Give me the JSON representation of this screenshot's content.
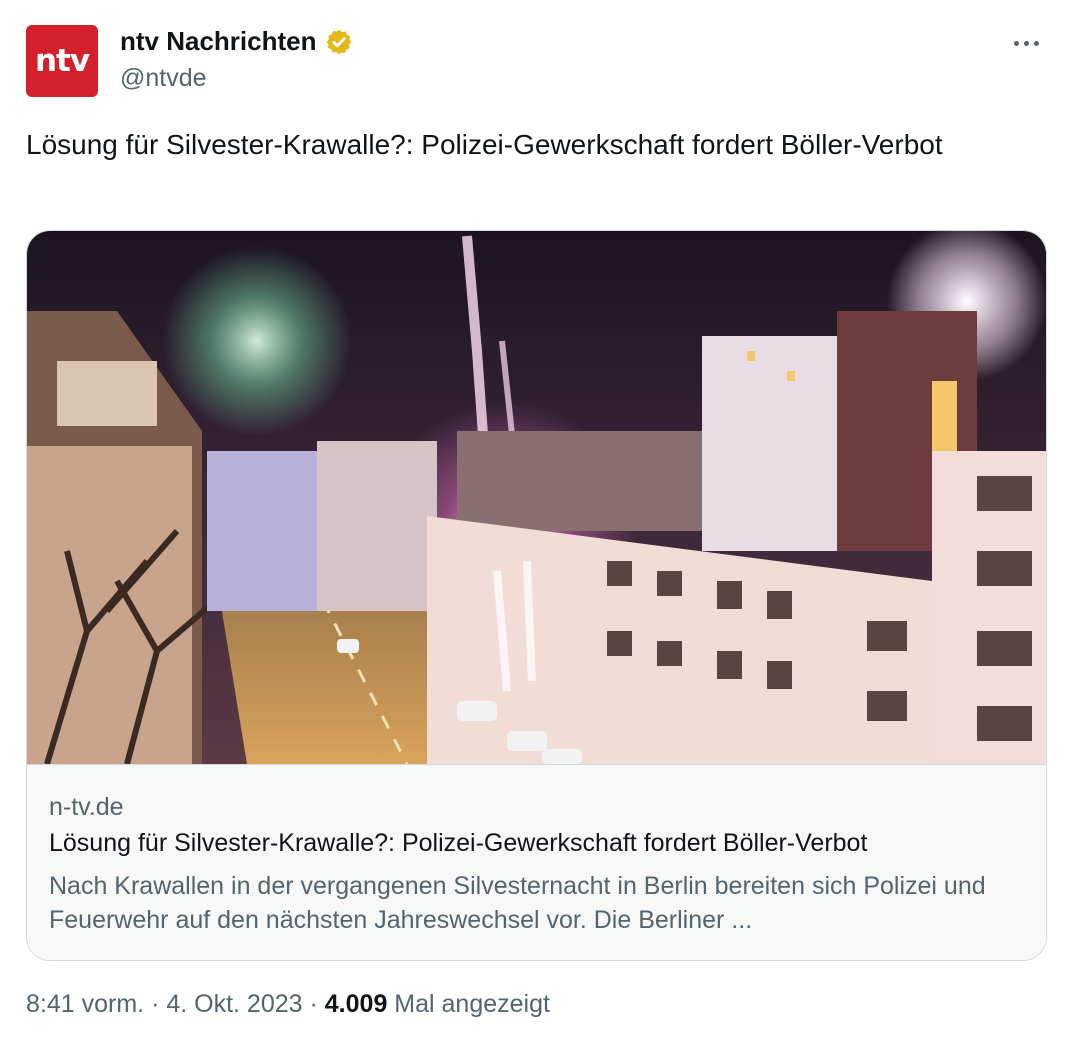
{
  "author": {
    "avatar_text": "ntv",
    "avatar_color": "#d3202a",
    "display_name": "ntv Nachrichten",
    "verified_badge": "gold-verified-icon",
    "handle": "@ntvde"
  },
  "more_icon": "more-horizontal-icon",
  "tweet": {
    "text": "Lösung für Silvester-Krawalle?: Polizei-Gewerkschaft fordert Böller-Verbot"
  },
  "link_card": {
    "image": "night-street-fireworks-photo",
    "domain": "n-tv.de",
    "title": "Lösung für Silvester-Krawalle?: Polizei-Gewerkschaft fordert Böller-Verbot",
    "description": "Nach Krawallen in der vergangenen Silvesternacht in Berlin bereiten sich Polizei und Feuerwehr auf den nächsten Jahreswechsel vor. Die Berliner ..."
  },
  "meta": {
    "time": "8:41 vorm.",
    "separator": "·",
    "date": "4. Okt. 2023",
    "views_count": "4.009",
    "views_label": "Mal angezeigt"
  },
  "colors": {
    "text_primary": "#0f1419",
    "text_secondary": "#536471",
    "border": "#cfd9de",
    "card_bg": "#f7f9f9",
    "verified_gold": "#e2b719"
  }
}
